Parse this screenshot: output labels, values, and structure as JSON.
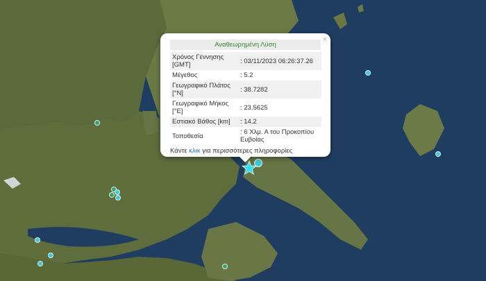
{
  "popup": {
    "title": "Αναθεωρημένη Λύση",
    "close_label": "×",
    "rows": [
      {
        "label": "Χρόνος Γέννησης [GMT]",
        "value": ": 03/11/2023 06:26:37.26"
      },
      {
        "label": "Μέγεθος",
        "value": ": 5.2"
      },
      {
        "label": "Γεωγραφικό Πλάτος [°N]",
        "value": ": 38.7282"
      },
      {
        "label": "Γεωγραφικό Μήκος [°E]",
        "value": ": 23.5625"
      },
      {
        "label": "Εστιακό Βάθος [km]",
        "value": ": 14.2"
      },
      {
        "label": "Τοποθεσία",
        "value": ": 6 Χλμ. Α του Προκοπίου Ευβοίας"
      }
    ],
    "footer_prefix": "Κάντε ",
    "footer_link": "κλικ",
    "footer_suffix": " για περισσότερες πληροφορίες"
  },
  "colors": {
    "sea": "#1e3a5c",
    "land": "#5c6b3a",
    "marker_cyan": "#3fc7d6",
    "marker_green": "#34a36a",
    "epicenter_star": "#34e0f0",
    "title_green": "#2f8a2f",
    "link_blue": "#2a6fc0"
  },
  "icons": {
    "epicenter": "star-icon",
    "close": "close-icon"
  }
}
